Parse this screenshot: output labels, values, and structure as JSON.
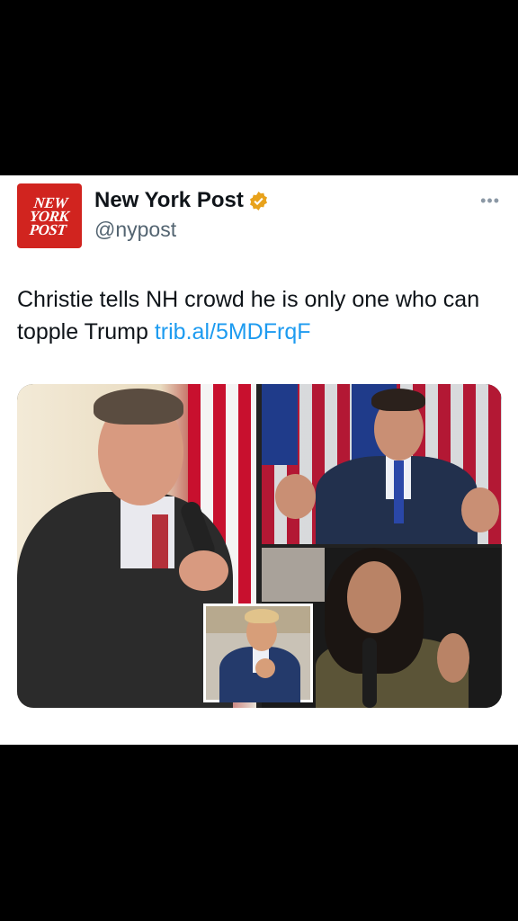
{
  "tweet": {
    "author": {
      "name": "New York Post",
      "handle": "@nypost",
      "logo_lines": [
        "NEW",
        "YORK",
        "POST"
      ],
      "verified": true,
      "verified_color": "#e8a21b",
      "logo_color": "#d1241f"
    },
    "more_icon": "more-dots-icon",
    "text": "Christie tells NH crowd he is only one who can topple Trump",
    "link": "trib.al/5MDFrqF",
    "link_color": "#1d9bf0",
    "media_count": 4
  }
}
